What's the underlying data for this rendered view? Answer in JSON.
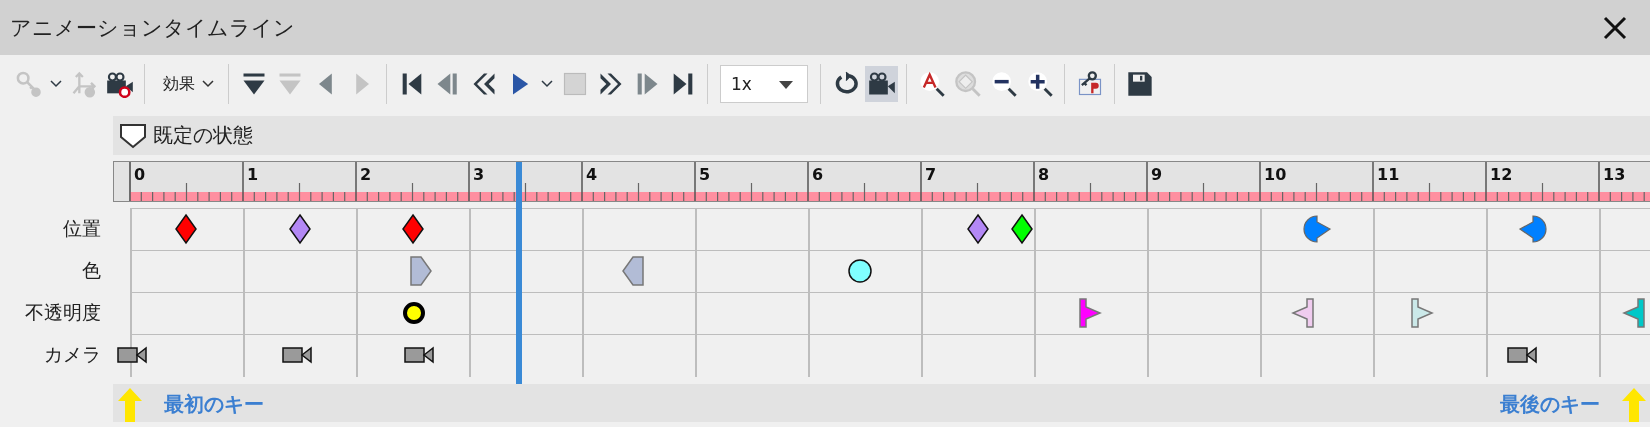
{
  "window": {
    "title": "アニメーションタイムライン"
  },
  "toolbar_groups": [
    [
      {
        "kind": "key",
        "disabled": true
      },
      {
        "kind": "chevron",
        "disabled": false
      },
      {
        "kind": "axes",
        "disabled": true
      },
      {
        "kind": "camera-record",
        "disabled": false
      }
    ],
    [
      {
        "kind": "menu",
        "label": "効果",
        "disabled": false
      }
    ],
    [
      {
        "kind": "insert-key",
        "disabled": false
      },
      {
        "kind": "insert-key",
        "disabled": true
      },
      {
        "kind": "tri-left",
        "disabled": false
      },
      {
        "kind": "tri-right",
        "disabled": true
      }
    ],
    [
      {
        "kind": "first",
        "disabled": false
      },
      {
        "kind": "prev-frame",
        "disabled": false
      },
      {
        "kind": "rewind",
        "disabled": false
      },
      {
        "kind": "play",
        "disabled": false
      },
      {
        "kind": "chevron",
        "disabled": false
      },
      {
        "kind": "stop",
        "disabled": true
      },
      {
        "kind": "forward",
        "disabled": false
      },
      {
        "kind": "next-frame",
        "disabled": false
      },
      {
        "kind": "last",
        "disabled": false
      }
    ],
    [
      {
        "kind": "select",
        "value": "1x",
        "disabled": false
      }
    ],
    [
      {
        "kind": "loop",
        "disabled": false,
        "on": false
      },
      {
        "kind": "camera",
        "disabled": false,
        "on": true
      }
    ],
    [
      {
        "kind": "zoom-text",
        "disabled": false
      },
      {
        "kind": "zoom-fit",
        "disabled": true
      },
      {
        "kind": "zoom-out",
        "disabled": false
      },
      {
        "kind": "zoom-in",
        "disabled": false
      }
    ],
    [
      {
        "kind": "key-p",
        "disabled": false
      }
    ],
    [
      {
        "kind": "save",
        "disabled": false
      }
    ]
  ],
  "state_header": {
    "label": "既定の状態"
  },
  "ruler": {
    "labels": [
      "0",
      "1",
      "2",
      "3",
      "4",
      "5",
      "6",
      "7",
      "8",
      "9",
      "10",
      "11",
      "12",
      "13"
    ]
  },
  "playhead": {
    "level": 0.256
  },
  "tracks": [
    {
      "label": "位置",
      "keys": [
        {
          "level": 0.037,
          "kind": "diamond",
          "color": "#ff0000"
        },
        {
          "level": 0.112,
          "kind": "diamond",
          "color": "#b388f5"
        },
        {
          "level": 0.186,
          "kind": "diamond",
          "color": "#ff0000"
        },
        {
          "level": 0.558,
          "kind": "diamond",
          "color": "#b388f5"
        },
        {
          "level": 0.587,
          "kind": "diamond",
          "color": "#00ff00"
        },
        {
          "level": 0.781,
          "kind": "half-circle-right",
          "color": "#0080ff"
        },
        {
          "level": 0.923,
          "kind": "half-circle-left",
          "color": "#0080ff"
        }
      ]
    },
    {
      "label": "色",
      "keys": [
        {
          "level": 0.19,
          "kind": "pentagon-right",
          "color": "#b2bcd6"
        },
        {
          "level": 0.332,
          "kind": "pentagon-left",
          "color": "#b2bcd6"
        },
        {
          "level": 0.48,
          "kind": "circle",
          "color": "#80ffff"
        }
      ]
    },
    {
      "label": "不透明度",
      "keys": [
        {
          "level": 0.187,
          "kind": "ring",
          "color": "#ffff00"
        },
        {
          "level": 0.63,
          "kind": "flag-right",
          "color": "#ff00ff"
        },
        {
          "level": 0.773,
          "kind": "flag-left",
          "color": "#f0ccef"
        },
        {
          "level": 0.849,
          "kind": "flag-right",
          "color": "#cbe9e9"
        },
        {
          "level": 0.991,
          "kind": "flag-left",
          "color": "#00c8c8"
        }
      ]
    },
    {
      "label": "カメラ",
      "keys": [
        {
          "level": 0.001,
          "kind": "camera",
          "color": "#9a9a9a"
        },
        {
          "level": 0.11,
          "kind": "camera",
          "color": "#9a9a9a"
        },
        {
          "level": 0.19,
          "kind": "camera",
          "color": "#9a9a9a"
        },
        {
          "level": 0.916,
          "kind": "camera",
          "color": "#9a9a9a"
        }
      ]
    }
  ],
  "markers": [
    {
      "label": "最初のキー"
    },
    {
      "label": "最後のキー"
    }
  ]
}
